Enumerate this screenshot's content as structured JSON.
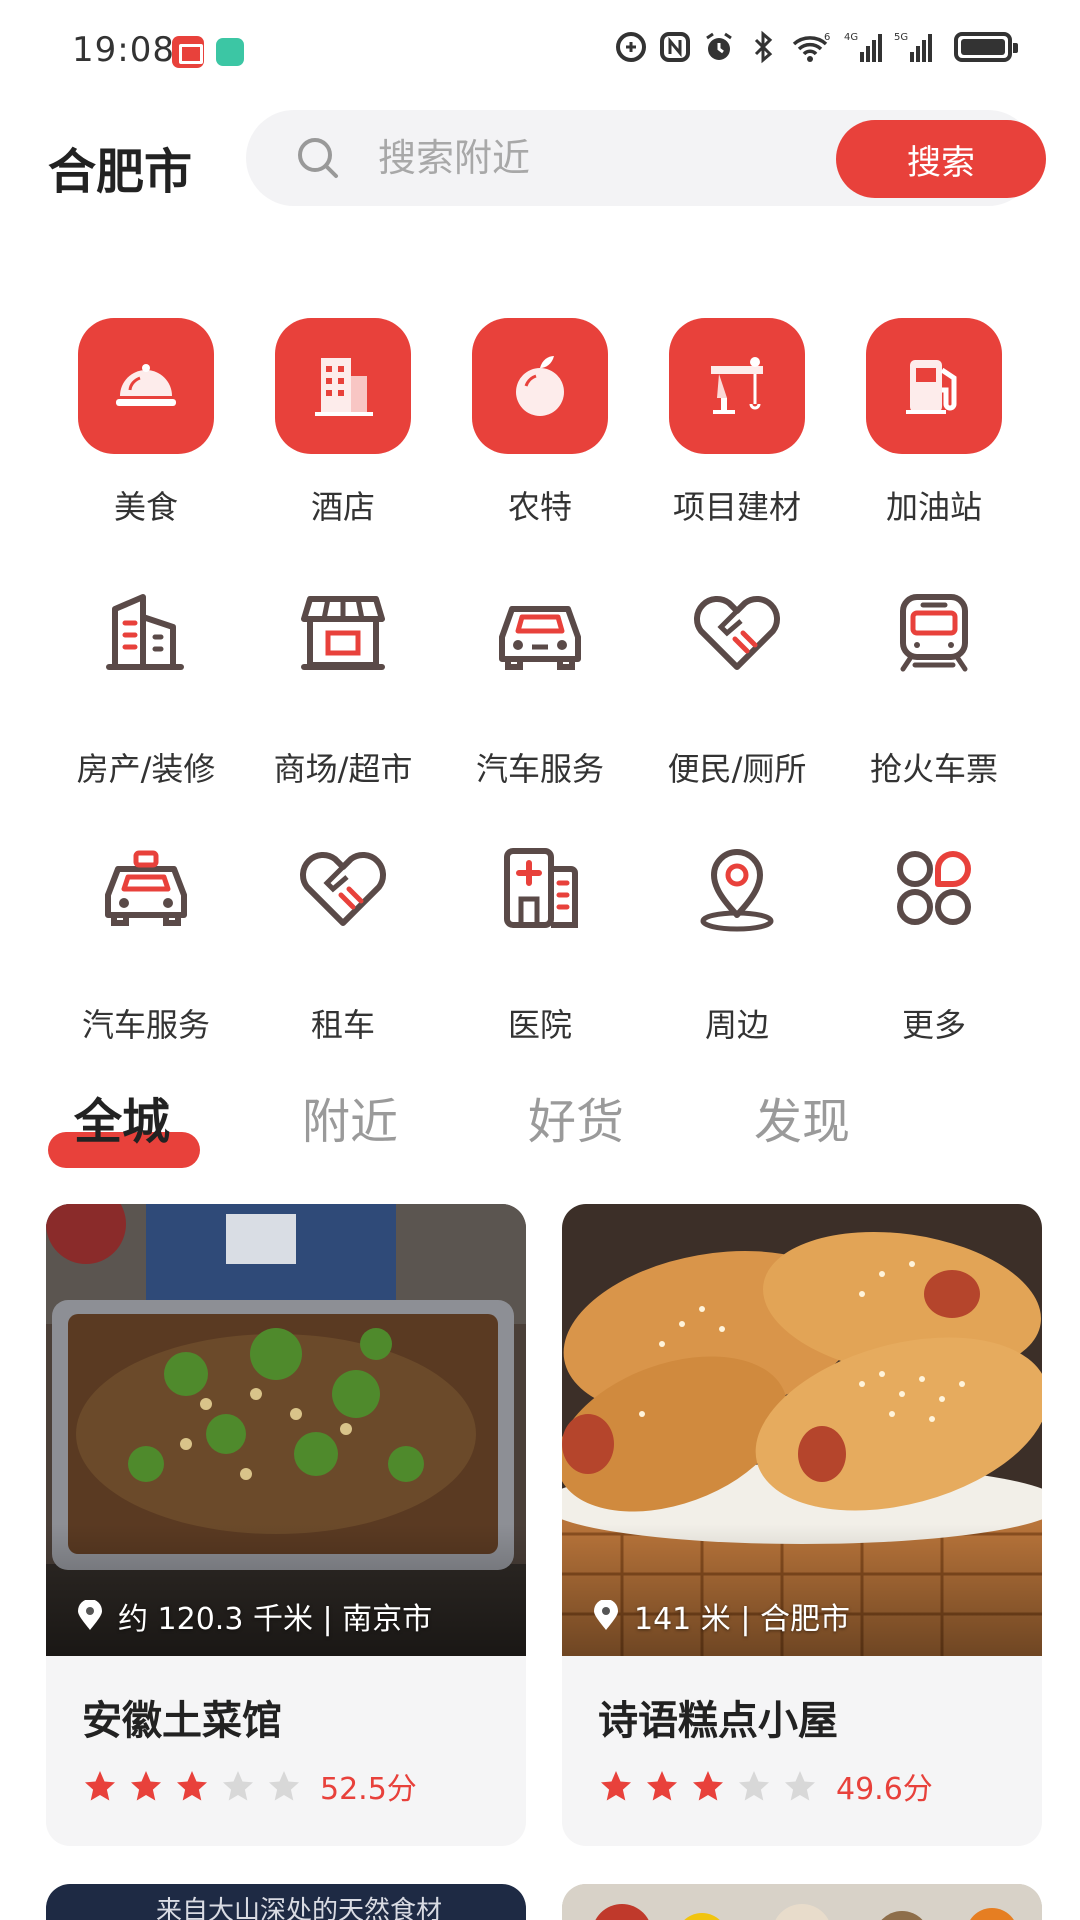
{
  "status_bar": {
    "time": "19:08",
    "icons": [
      "app-red-icon",
      "app-green-icon",
      "sync-icon",
      "nfc-icon",
      "alarm-icon",
      "bluetooth-icon",
      "wifi-icon",
      "signal-4g-icon",
      "signal-5g-icon",
      "battery-icon"
    ],
    "wifi_badge": "6",
    "net1": "4G",
    "net2": "5G"
  },
  "header": {
    "city": "合肥市",
    "search_placeholder": "搜索附近",
    "search_button": "搜索"
  },
  "categories_row1": [
    {
      "label": "美食",
      "icon": "food-cloche-icon"
    },
    {
      "label": "酒店",
      "icon": "hotel-building-icon"
    },
    {
      "label": "农特",
      "icon": "fruit-icon"
    },
    {
      "label": "项目建材",
      "icon": "crane-icon"
    },
    {
      "label": "加油站",
      "icon": "gas-station-icon"
    }
  ],
  "categories_row2": [
    {
      "label": "房产/装修",
      "icon": "building-icon"
    },
    {
      "label": "商场/超市",
      "icon": "storefront-icon"
    },
    {
      "label": "汽车服务",
      "icon": "car-icon"
    },
    {
      "label": "便民/厕所",
      "icon": "handshake-heart-icon"
    },
    {
      "label": "抢火车票",
      "icon": "train-icon"
    }
  ],
  "categories_row3": [
    {
      "label": "汽车服务",
      "icon": "taxi-icon"
    },
    {
      "label": "租车",
      "icon": "handshake-heart-icon"
    },
    {
      "label": "医院",
      "icon": "hospital-icon"
    },
    {
      "label": "周边",
      "icon": "map-pin-icon"
    },
    {
      "label": "更多",
      "icon": "more-grid-icon"
    }
  ],
  "tabs": [
    "全城",
    "附近",
    "好货",
    "发现"
  ],
  "active_tab": "全城",
  "cards": [
    {
      "distance": "约 120.3 千米 | 南京市",
      "title": "安徽土菜馆",
      "stars": 3,
      "max_stars": 5,
      "score": "52.5分"
    },
    {
      "distance": "141 米 | 合肥市",
      "title": "诗语糕点小屋",
      "stars": 3,
      "max_stars": 5,
      "score": "49.6分"
    }
  ],
  "next_cards": [
    {
      "caption": "来自大山深处的天然食材"
    }
  ],
  "colors": {
    "accent": "#e8413b",
    "icon_outline": "#5a4a48",
    "inactive_star": "#d8d8d8",
    "card_bg": "#f5f5f6"
  }
}
